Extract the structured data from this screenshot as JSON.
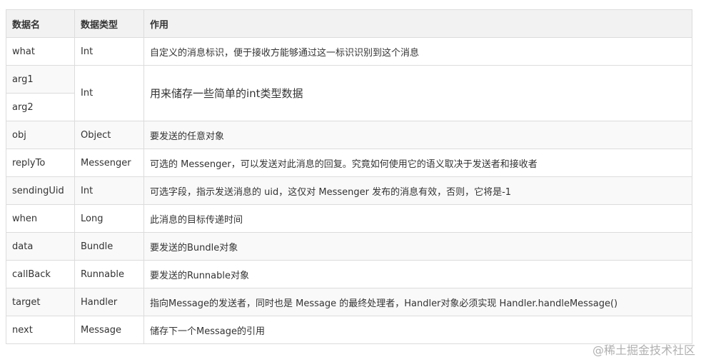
{
  "table": {
    "headers": [
      "数据名",
      "数据类型",
      "作用"
    ],
    "rows": [
      {
        "name": "what",
        "type": "Int",
        "desc": "自定义的消息标识，便于接收方能够通过这一标识识别到这个消息"
      },
      {
        "name": "arg1",
        "type": "Int",
        "desc": "用来储存一些简单的int类型数据"
      },
      {
        "name": "arg2"
      },
      {
        "name": "obj",
        "type": "Object",
        "desc": "要发送的任意对象"
      },
      {
        "name": "replyTo",
        "type": "Messenger",
        "desc": "可选的 Messenger，可以发送对此消息的回复。究竟如何使用它的语义取决于发送者和接收者"
      },
      {
        "name": "sendingUid",
        "type": "Int",
        "desc": "可选字段，指示发送消息的 uid，这仅对 Messenger 发布的消息有效，否则，它将是-1"
      },
      {
        "name": "when",
        "type": "Long",
        "desc": "此消息的目标传递时间"
      },
      {
        "name": "data",
        "type": "Bundle",
        "desc": "要发送的Bundle对象"
      },
      {
        "name": "callBack",
        "type": "Runnable",
        "desc": "要发送的Runnable对象"
      },
      {
        "name": "target",
        "type": "Handler",
        "desc": "指向Message的发送者，同时也是 Message 的最终处理者，Handler对象必须实现 Handler.handleMessage()"
      },
      {
        "name": "next",
        "type": "Message",
        "desc": "储存下一个Message的引用"
      }
    ]
  },
  "watermark": "@稀土掘金技术社区"
}
